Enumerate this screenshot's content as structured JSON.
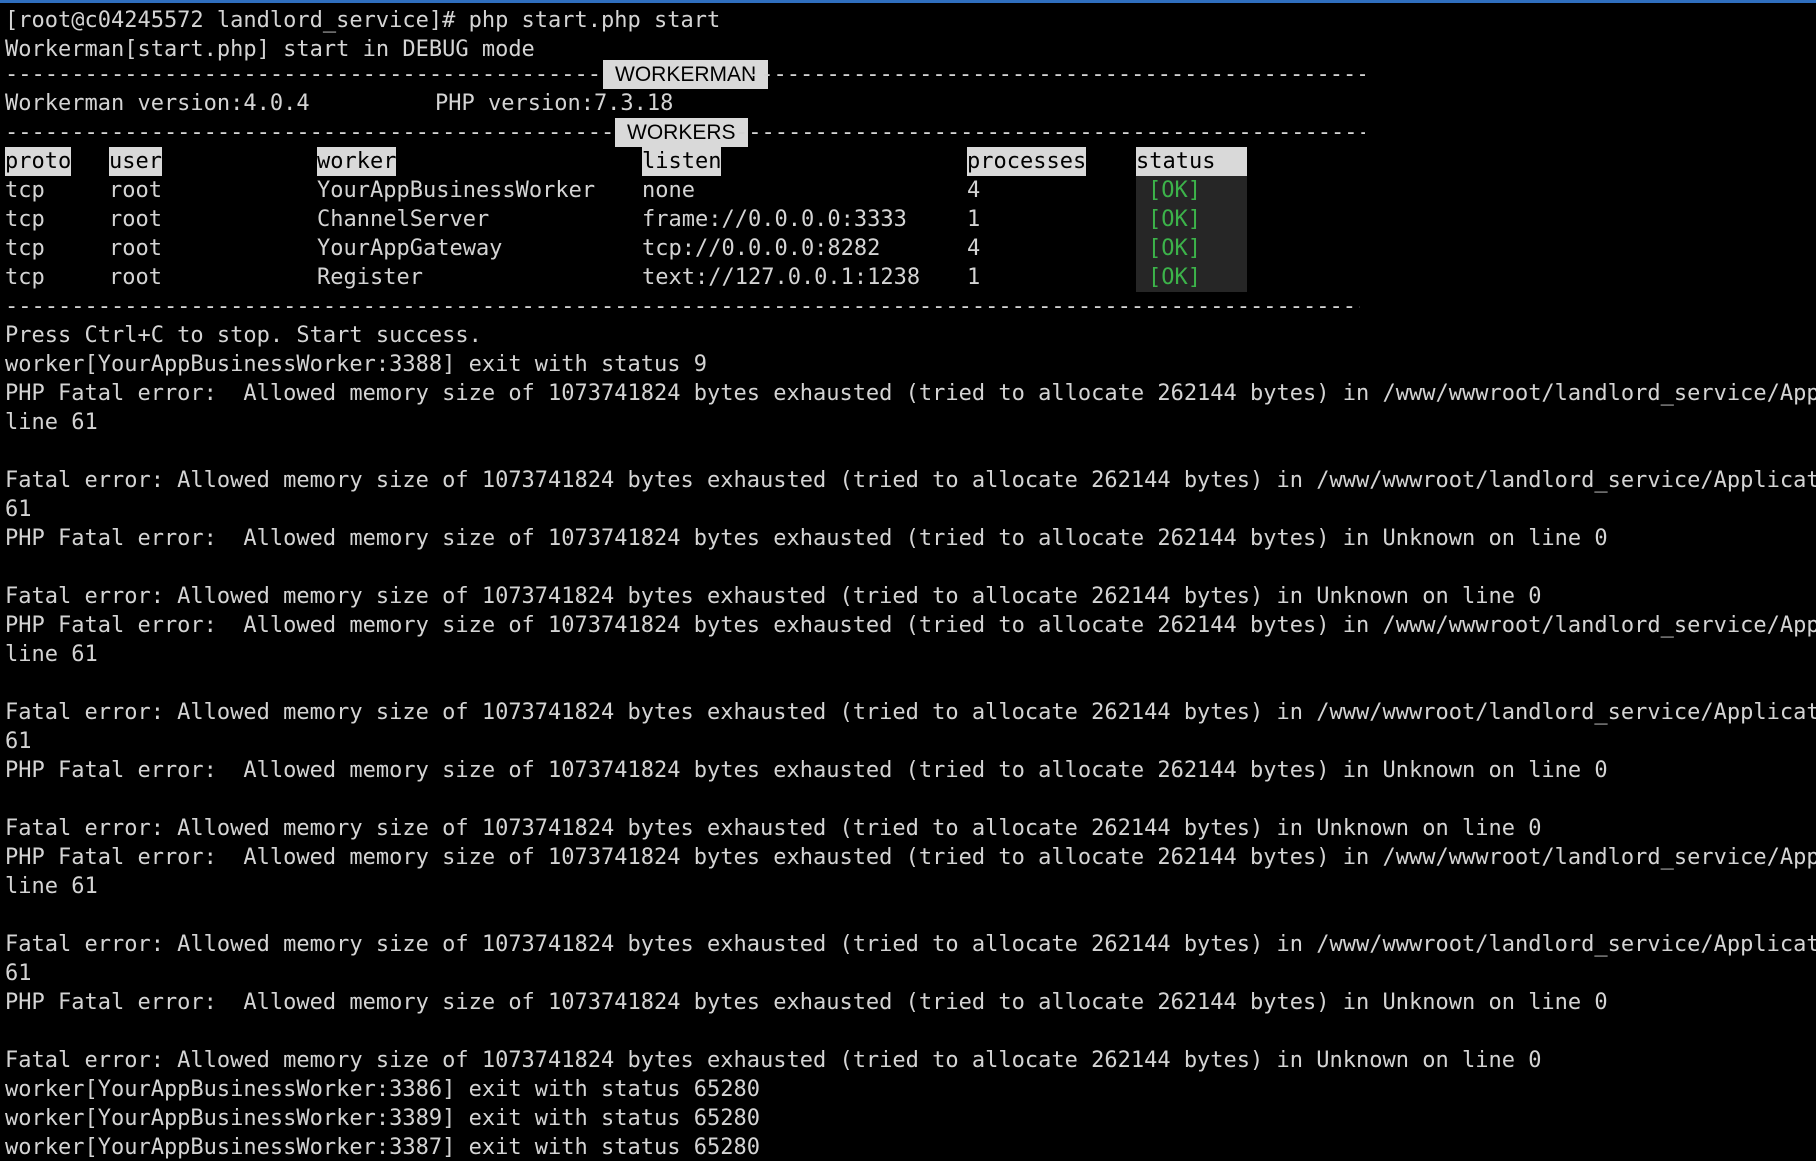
{
  "prompt_line": "[root@c04245572 landlord_service]# php start.php start",
  "debug_line": "Workerman[start.php] start in DEBUG mode",
  "banner_workerman": {
    "title": "WORKERMAN",
    "dashes_left": "----------------------------------------------",
    "dashes_right": "---------------------------------------------------"
  },
  "versions": {
    "workerman": "Workerman version:4.0.4",
    "php": "PHP version:7.3.18"
  },
  "banner_workers": {
    "title": "WORKERS",
    "dashes_left": "-----------------------------------------------",
    "dashes_right": "----------------------------------------------------"
  },
  "table": {
    "headers": {
      "proto": "proto",
      "user": "user",
      "worker": "worker",
      "listen": "listen",
      "processes": "processes",
      "status": "status"
    },
    "rows": [
      {
        "proto": "tcp",
        "user": "root",
        "worker": "YourAppBusinessWorker",
        "listen": "none",
        "processes": "4",
        "status": "[OK]"
      },
      {
        "proto": "tcp",
        "user": "root",
        "worker": "ChannelServer",
        "listen": "frame://0.0.0.0:3333",
        "processes": "1",
        "status": "[OK]"
      },
      {
        "proto": "tcp",
        "user": "root",
        "worker": "YourAppGateway",
        "listen": "tcp://0.0.0.0:8282",
        "processes": "4",
        "status": "[OK]"
      },
      {
        "proto": "tcp",
        "user": "root",
        "worker": "Register",
        "listen": "text://127.0.0.1:1238",
        "processes": "1",
        "status": "[OK]"
      }
    ]
  },
  "separator": "----------------------------------------------------------------------------------------------------------",
  "log": [
    "Press Ctrl+C to stop. Start success.",
    "worker[YourAppBusinessWorker:3388] exit with status 9",
    "PHP Fatal error:  Allowed memory size of 1073741824 bytes exhausted (tried to allocate 262144 bytes) in /www/wwwroot/landlord_service/Applic",
    "line 61",
    "",
    "Fatal error: Allowed memory size of 1073741824 bytes exhausted (tried to allocate 262144 bytes) in /www/wwwroot/landlord_service/Application",
    "61",
    "PHP Fatal error:  Allowed memory size of 1073741824 bytes exhausted (tried to allocate 262144 bytes) in Unknown on line 0",
    "",
    "Fatal error: Allowed memory size of 1073741824 bytes exhausted (tried to allocate 262144 bytes) in Unknown on line 0",
    "PHP Fatal error:  Allowed memory size of 1073741824 bytes exhausted (tried to allocate 262144 bytes) in /www/wwwroot/landlord_service/Applic",
    "line 61",
    "",
    "Fatal error: Allowed memory size of 1073741824 bytes exhausted (tried to allocate 262144 bytes) in /www/wwwroot/landlord_service/Application",
    "61",
    "PHP Fatal error:  Allowed memory size of 1073741824 bytes exhausted (tried to allocate 262144 bytes) in Unknown on line 0",
    "",
    "Fatal error: Allowed memory size of 1073741824 bytes exhausted (tried to allocate 262144 bytes) in Unknown on line 0",
    "PHP Fatal error:  Allowed memory size of 1073741824 bytes exhausted (tried to allocate 262144 bytes) in /www/wwwroot/landlord_service/Applic",
    "line 61",
    "",
    "Fatal error: Allowed memory size of 1073741824 bytes exhausted (tried to allocate 262144 bytes) in /www/wwwroot/landlord_service/Application",
    "61",
    "PHP Fatal error:  Allowed memory size of 1073741824 bytes exhausted (tried to allocate 262144 bytes) in Unknown on line 0",
    "",
    "Fatal error: Allowed memory size of 1073741824 bytes exhausted (tried to allocate 262144 bytes) in Unknown on line 0",
    "worker[YourAppBusinessWorker:3386] exit with status 65280",
    "worker[YourAppBusinessWorker:3389] exit with status 65280",
    "worker[YourAppBusinessWorker:3387] exit with status 65280"
  ],
  "colors": {
    "background": "#000000",
    "text": "#d4d4d4",
    "header_bg": "#d9d9d9",
    "ok_text": "#3cb34a",
    "ok_bg": "#262626",
    "title_bar_accent": "#2f6fbf"
  }
}
